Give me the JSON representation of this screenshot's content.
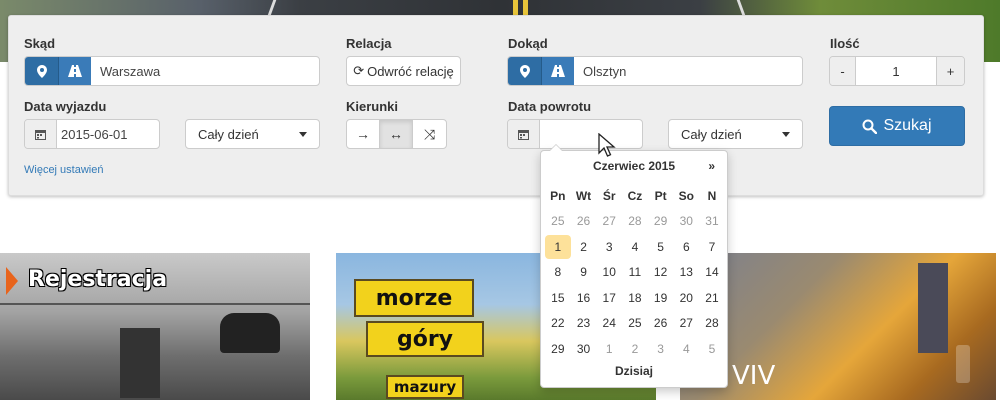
{
  "form": {
    "from": {
      "label": "Skąd",
      "value": "Warszawa"
    },
    "relation": {
      "label": "Relacja",
      "reverse_label": "Odwróć relację"
    },
    "to": {
      "label": "Dokąd",
      "value": "Olsztyn"
    },
    "quantity": {
      "label": "Ilość",
      "value": "1",
      "minus": "-",
      "plus": "+"
    },
    "departure": {
      "label": "Data wyjazdu",
      "value": "2015-06-01",
      "time_option": "Cały dzień"
    },
    "direction": {
      "label": "Kierunki",
      "options": [
        "→",
        "↔",
        "⤨"
      ],
      "selected": 1
    },
    "return": {
      "label": "Data powrotu",
      "value": "",
      "time_option": "Cały dzień"
    },
    "search_label": "Szukaj",
    "more_settings": "Więcej ustawień"
  },
  "datepicker": {
    "month": "Czerwiec 2015",
    "next": "»",
    "weekdays": [
      "Pn",
      "Wt",
      "Śr",
      "Cz",
      "Pt",
      "So",
      "N"
    ],
    "weeks": [
      [
        "25",
        "26",
        "27",
        "28",
        "29",
        "30",
        "31"
      ],
      [
        "1",
        "2",
        "3",
        "4",
        "5",
        "6",
        "7"
      ],
      [
        "8",
        "9",
        "10",
        "11",
        "12",
        "13",
        "14"
      ],
      [
        "15",
        "16",
        "17",
        "18",
        "19",
        "20",
        "21"
      ],
      [
        "22",
        "23",
        "24",
        "25",
        "26",
        "27",
        "28"
      ],
      [
        "29",
        "30",
        "1",
        "2",
        "3",
        "4",
        "5"
      ]
    ],
    "today": "Dzisiaj"
  },
  "tiles": {
    "registration": "Rejestracja",
    "sign_sea": "morze",
    "sign_mountains": "góry",
    "sign_lakes": "mazury",
    "lviv": "VIV"
  },
  "colors": {
    "primary": "#337ab7",
    "today_highlight": "#fde19a"
  }
}
